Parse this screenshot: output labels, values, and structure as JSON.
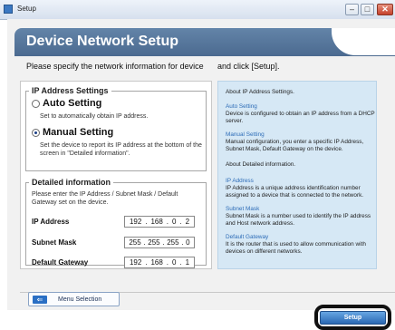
{
  "window": {
    "title": "Setup",
    "minimize_glyph": "–",
    "maximize_glyph": "□",
    "close_glyph": "✕"
  },
  "header": {
    "title": "Device Network Setup"
  },
  "instruction": {
    "part1": "Please specify the network information for device",
    "part2": "and click [Setup]."
  },
  "ip_settings": {
    "legend": "IP Address Settings",
    "auto": {
      "label": "Auto Setting",
      "desc": "Set to automatically obtain IP address.",
      "selected": false
    },
    "manual": {
      "label": "Manual Setting",
      "desc": "Set the device to report its IP address at the bottom of the screen in \"Detailed information\".",
      "selected": true
    }
  },
  "detailed_info": {
    "legend": "Detailed information",
    "desc": "Please enter the IP Address / Subnet Mask / Default Gateway set on the device.",
    "fields": [
      {
        "label": "IP Address",
        "octets": [
          "192",
          "168",
          "0",
          "2"
        ]
      },
      {
        "label": "Subnet Mask",
        "octets": [
          "255",
          "255",
          "255",
          "0"
        ]
      },
      {
        "label": "Default Gateway",
        "octets": [
          "192",
          "168",
          "0",
          "1"
        ]
      }
    ],
    "separator": "."
  },
  "help": {
    "intro": "About IP Address Settings.",
    "auto_head": "Auto Setting",
    "auto_body": "Device is configured to obtain an IP address from a DHCP server.",
    "manual_head": "Manual Setting",
    "manual_body": "Manual configuration, you enter a specific IP Address, Subnet Mask, Default Gateway on the device.",
    "detail_intro": "About Detailed information.",
    "ip_head": "IP Address",
    "ip_body": "IP Address is a unique address identification number assigned to a device that is connected to the network.",
    "subnet_head": "Subnet Mask",
    "subnet_body": "Subnet Mask is a number used to identify the IP address and Host network address.",
    "gateway_head": "Default Gateway",
    "gateway_body": "It is the router that is used to allow communication with devices on different networks."
  },
  "footer": {
    "menu_button": "Menu Selection",
    "menu_arrow": "⇐",
    "setup_button": "Setup"
  },
  "colors": {
    "header": "#5677a0",
    "help_panel": "#d6e8f5",
    "accent": "#2a6fc4"
  }
}
